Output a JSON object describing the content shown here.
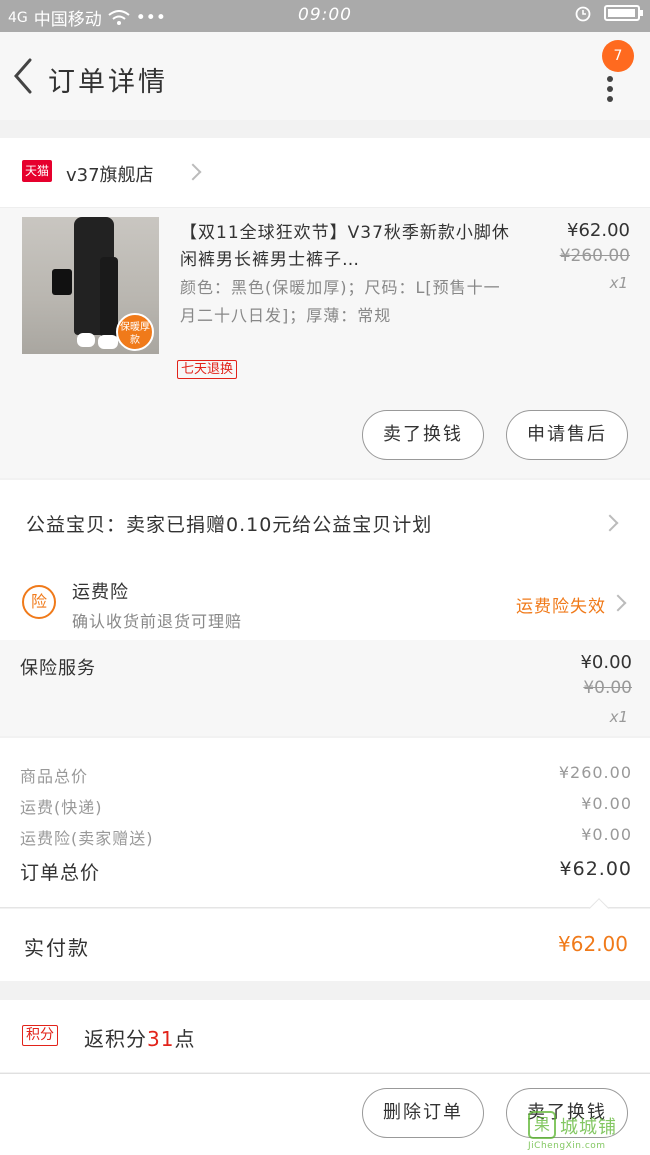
{
  "status_bar": {
    "carrier": "中国移动",
    "signal": "4G",
    "dots": "•••",
    "time": "09:00",
    "battery_level": 0.95
  },
  "nav": {
    "title": "订单详情",
    "badge": "7"
  },
  "shop": {
    "platform_tag": "天猫",
    "name": "v37旗舰店"
  },
  "product": {
    "image_badge": "保暖厚款",
    "title": "【双11全球狂欢节】V37秋季新款小脚休闲裤男长裤男士裤子…",
    "spec": "颜色：黑色(保暖加厚)；尺码：L[预售十一月二十八日发]；厚薄：常规",
    "return_tag": "七天退换",
    "price": "¥62.00",
    "original_price": "¥260.00",
    "quantity": "x1"
  },
  "actions": {
    "sell_button": "卖了换钱",
    "after_sale_button": "申请售后"
  },
  "charity": {
    "text": "公益宝贝：卖家已捐赠0.10元给公益宝贝计划"
  },
  "shipping_insurance": {
    "icon_label": "险",
    "title": "运费险",
    "subtitle": "确认收货前退货可理赔",
    "status": "运费险失效"
  },
  "insurance_service": {
    "label": "保险服务",
    "price": "¥0.00",
    "original_price": "¥0.00",
    "quantity": "x1"
  },
  "totals": {
    "goods_label": "商品总价",
    "goods_value": "¥260.00",
    "shipping_label": "运费(快递)",
    "shipping_value": "¥0.00",
    "insurance_label": "运费险(卖家赠送)",
    "insurance_value": "¥0.00",
    "order_total_label": "订单总价",
    "order_total_value": "¥62.00"
  },
  "paid": {
    "label": "实付款",
    "value": "¥62.00"
  },
  "points": {
    "tag": "积分",
    "prefix": "返积分",
    "count": "31",
    "suffix": "点"
  },
  "bottom_bar": {
    "delete_button": "删除订单",
    "sell_button": "卖了换钱"
  },
  "watermark": {
    "icon": "果",
    "text": "城城铺",
    "url": "JiChengXin.com"
  },
  "colors": {
    "accent": "#f07a1a",
    "tmall_red": "#e6002d",
    "badge": "#ff6a1f"
  }
}
